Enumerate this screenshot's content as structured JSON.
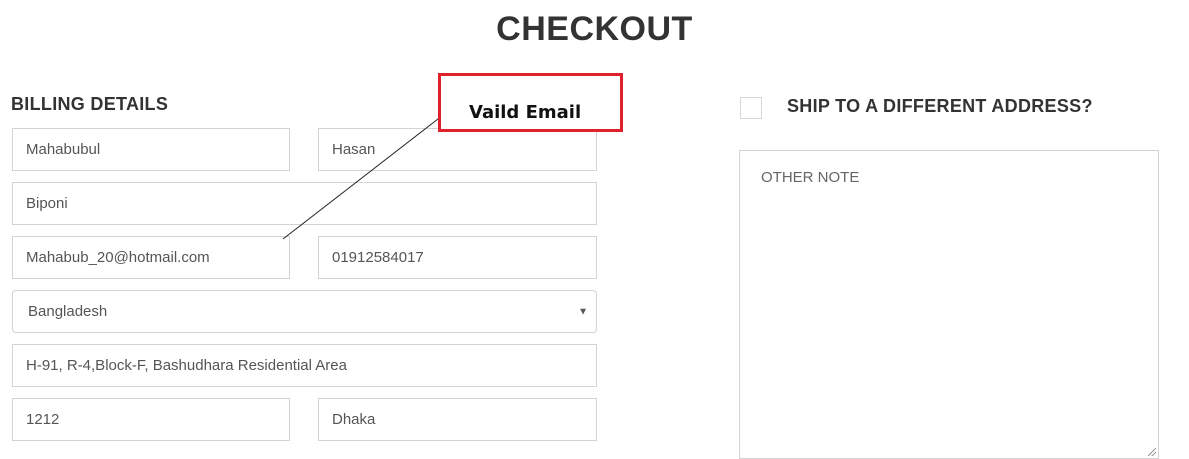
{
  "page": {
    "title": "CHECKOUT"
  },
  "billing": {
    "title": "BILLING DETAILS",
    "first_name": "Mahabubul",
    "last_name": "Hasan",
    "company": "Biponi",
    "email": "Mahabub_20@hotmail.com",
    "phone": "01912584017",
    "country": "Bangladesh",
    "address": "H-91, R-4,Block-F, Bashudhara Residential Area",
    "postcode": "1212",
    "city": "Dhaka"
  },
  "annotation": {
    "text": "Vaild Email",
    "border_color": "#e0202a"
  },
  "shipping": {
    "checkbox_checked": false,
    "label": "SHIP TO A DIFFERENT ADDRESS?",
    "note_placeholder": "OTHER NOTE"
  },
  "icons": {
    "select_arrow": "triangle-down-icon",
    "resize_grip": "resize-grip-icon"
  }
}
